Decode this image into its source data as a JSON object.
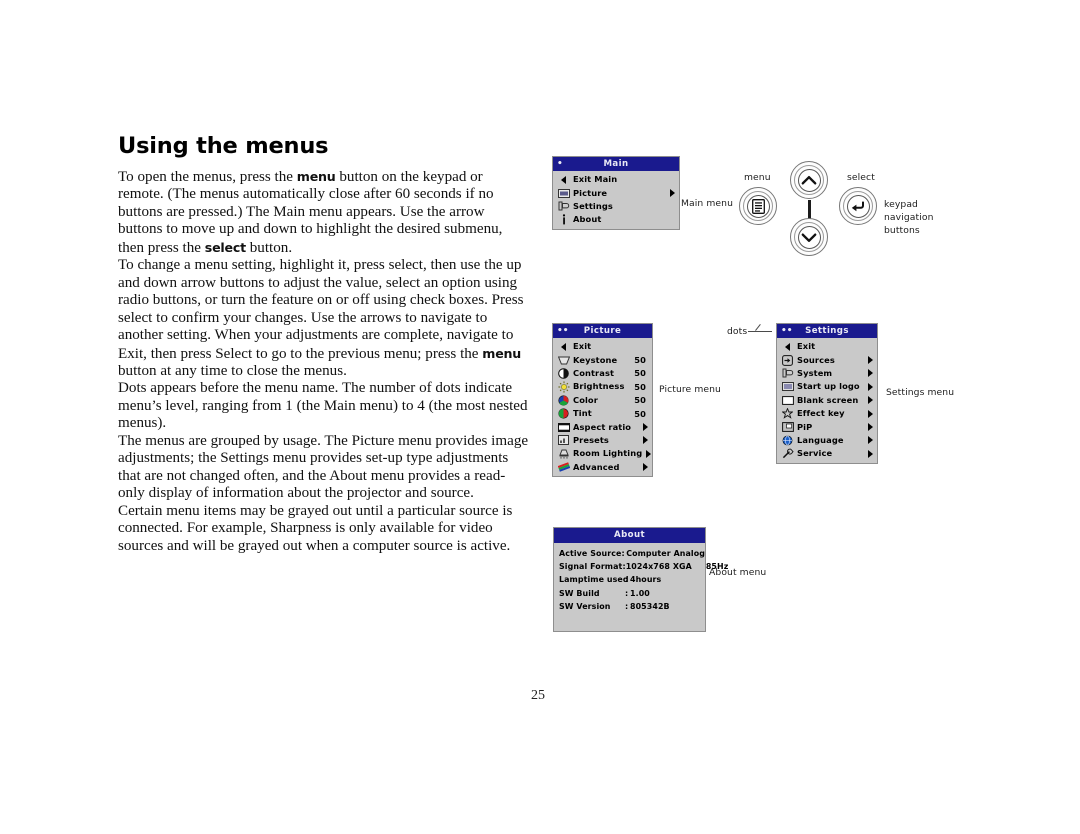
{
  "page": {
    "title": "Using the menus",
    "number": "25",
    "paragraphs": [
      "To open the menus, press the <b>menu</b> button on the keypad or remote. (The menus automatically close after 60 seconds if no buttons are pressed.) The Main menu appears. Use the arrow buttons to move up and down to highlight the desired submenu, then press the <b>select</b> button.",
      "To change a menu setting, highlight it, press select, then use the up and down arrow buttons to adjust the value, select an option using radio buttons, or turn the feature on or off using check boxes. Press select to confirm your changes. Use the arrows to navigate to another setting. When your adjustments are complete, navigate to Exit, then press Select to go to the previous menu; press the <b>menu</b> button at any time to close the menus.",
      "Dots appears before the menu name. The number of dots indicate menu’s level, ranging from 1 (the Main menu) to 4 (the most nested menus).",
      "The menus are grouped by usage. The Picture menu provides image adjustments; the Settings menu provides set-up type adjustments that are not changed often, and the About menu provides a read-only display of information about the projector and source.",
      "Certain menu items may be grayed out until a particular source is connected. For example, Sharpness is only available for video sources and will be grayed out when a computer source is active."
    ]
  },
  "colors": {
    "title_bar": "#1a1a8e",
    "menu_body": "#c9c9c9",
    "menu_border": "#8e8e8e",
    "title_text": "#e9e9f5"
  },
  "menus": {
    "main": {
      "title": "Main",
      "dots": "•",
      "dot_count": 1,
      "items": [
        {
          "label": "Exit Main",
          "icon": "arrow-left-icon",
          "value": "",
          "submenu": false
        },
        {
          "label": "Picture",
          "icon": "picture-icon",
          "value": "",
          "submenu": true
        },
        {
          "label": "Settings",
          "icon": "settings-hand-icon",
          "value": "",
          "submenu": false
        },
        {
          "label": "About",
          "icon": "info-icon",
          "value": "",
          "submenu": false
        }
      ]
    },
    "picture": {
      "title": "Picture",
      "dots": "••",
      "dot_count": 2,
      "items": [
        {
          "label": "Exit",
          "icon": "arrow-left-icon",
          "value": "",
          "submenu": false
        },
        {
          "label": "Keystone",
          "icon": "keystone-icon",
          "value": "50",
          "submenu": false
        },
        {
          "label": "Contrast",
          "icon": "contrast-icon",
          "value": "50",
          "submenu": false
        },
        {
          "label": "Brightness",
          "icon": "brightness-icon",
          "value": "50",
          "submenu": false
        },
        {
          "label": "Color",
          "icon": "color-icon",
          "value": "50",
          "submenu": false
        },
        {
          "label": "Tint",
          "icon": "tint-icon",
          "value": "50",
          "submenu": false
        },
        {
          "label": "Aspect ratio",
          "icon": "aspect-ratio-icon",
          "value": "",
          "submenu": true
        },
        {
          "label": "Presets",
          "icon": "presets-icon",
          "value": "",
          "submenu": true
        },
        {
          "label": "Room Lighting",
          "icon": "room-lighting-icon",
          "value": "",
          "submenu": true
        },
        {
          "label": "Advanced",
          "icon": "advanced-icon",
          "value": "",
          "submenu": true
        }
      ]
    },
    "settings": {
      "title": "Settings",
      "dots": "••",
      "dot_count": 2,
      "items": [
        {
          "label": "Exit",
          "icon": "arrow-left-icon",
          "value": "",
          "submenu": false
        },
        {
          "label": "Sources",
          "icon": "sources-icon",
          "value": "",
          "submenu": true
        },
        {
          "label": "System",
          "icon": "system-icon",
          "value": "",
          "submenu": true
        },
        {
          "label": "Start up logo",
          "icon": "startup-logo-icon",
          "value": "",
          "submenu": true
        },
        {
          "label": "Blank screen",
          "icon": "blank-screen-icon",
          "value": "",
          "submenu": true
        },
        {
          "label": "Effect key",
          "icon": "star-icon",
          "value": "",
          "submenu": true
        },
        {
          "label": "PiP",
          "icon": "pip-icon",
          "value": "",
          "submenu": true
        },
        {
          "label": "Language",
          "icon": "globe-icon",
          "value": "",
          "submenu": true
        },
        {
          "label": "Service",
          "icon": "wrench-icon",
          "value": "",
          "submenu": true
        }
      ]
    },
    "about": {
      "title": "About",
      "rows": [
        {
          "key": "Active Source",
          "sep": ":",
          "value": "Computer Analog",
          "value2": ""
        },
        {
          "key": "Signal Format",
          "sep": ":",
          "value": "1024x768 XGA",
          "value2": "85Hz"
        },
        {
          "key": "Lamptime used",
          "sep": ":",
          "value": "4hours",
          "value2": ""
        },
        {
          "key": "SW Build",
          "sep": ":",
          "value": "1.00",
          "value2": ""
        },
        {
          "key": "SW Version",
          "sep": ":",
          "value": "805342B",
          "value2": ""
        }
      ]
    }
  },
  "callouts": {
    "main_menu": "Main menu",
    "menu_button": "menu",
    "select_button": "select",
    "keypad_navigation": "keypad navigation buttons",
    "picture_menu": "Picture menu",
    "settings_menu": "Settings menu",
    "about_menu": "About menu",
    "dots": "dots"
  },
  "keypad": {
    "menu_icon": "menu-list-icon",
    "up_icon": "chevron-up-icon",
    "down_icon": "chevron-down-icon",
    "select_icon": "enter-arrow-icon"
  }
}
